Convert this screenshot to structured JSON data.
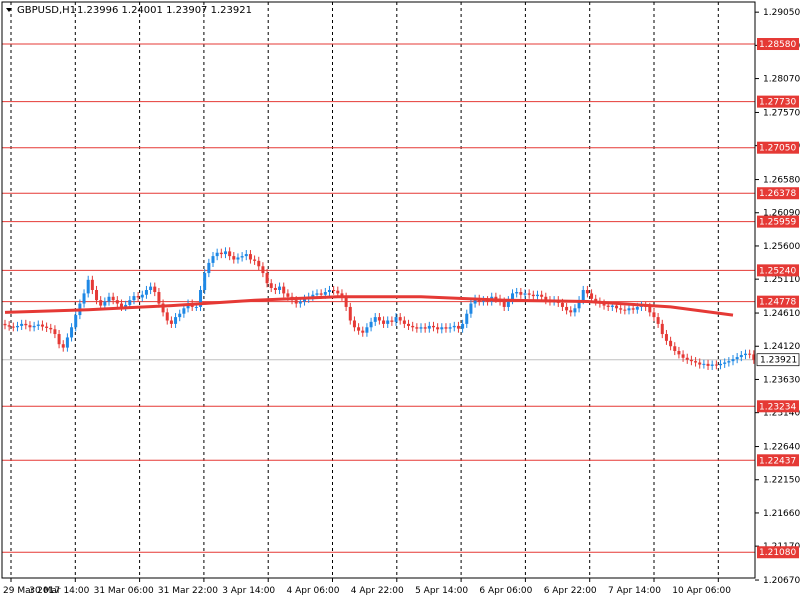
{
  "header": {
    "symbol": "GBPUSD,H1",
    "ohlc": "1.23996 1.24001 1.23907 1.23921"
  },
  "colors": {
    "background": "#ffffff",
    "up_candle": "#1e88e5",
    "down_candle": "#e53935",
    "level_line": "#e53935",
    "moving_average": "#e53935",
    "grid": "#000000"
  },
  "chart_data": {
    "type": "candlestick",
    "ylim": [
      1.207,
      1.292
    ],
    "y_ticks": [
      "1.29050",
      "1.28560",
      "1.28070",
      "1.27570",
      "1.27080",
      "1.26580",
      "1.26090",
      "1.25600",
      "1.25110",
      "1.24610",
      "1.24120",
      "1.23630",
      "1.23140",
      "1.22640",
      "1.22150",
      "1.21660",
      "1.21170",
      "1.20670"
    ],
    "x_labels": [
      "29 Mar 2017",
      "30 Mar 14:00",
      "31 Mar 06:00",
      "31 Mar 22:00",
      "3 Apr 14:00",
      "4 Apr 06:00",
      "4 Apr 22:00",
      "5 Apr 14:00",
      "6 Apr 06:00",
      "6 Apr 22:00",
      "7 Apr 14:00",
      "10 Apr 06:00"
    ],
    "levels": [
      "1.28580",
      "1.27730",
      "1.27050",
      "1.26378",
      "1.25959",
      "1.25240",
      "1.24778",
      "1.23234",
      "1.22437",
      "1.21080"
    ],
    "current_price": "1.23921",
    "grid": "vertical dashed",
    "closes": [
      1.2443,
      1.2441,
      1.244,
      1.2442,
      1.2445,
      1.2443,
      1.244,
      1.2442,
      1.2444,
      1.2441,
      1.2439,
      1.2437,
      1.243,
      1.2415,
      1.241,
      1.2425,
      1.244,
      1.2458,
      1.2475,
      1.249,
      1.251,
      1.2495,
      1.248,
      1.2472,
      1.2478,
      1.2485,
      1.248,
      1.2475,
      1.247,
      1.2473,
      1.248,
      1.2486,
      1.2484,
      1.2488,
      1.2495,
      1.25,
      1.2492,
      1.2475,
      1.2462,
      1.245,
      1.2445,
      1.2455,
      1.246,
      1.2468,
      1.2475,
      1.247,
      1.247,
      1.2495,
      1.252,
      1.2535,
      1.2545,
      1.255,
      1.2548,
      1.2552,
      1.2545,
      1.254,
      1.2543,
      1.2545,
      1.2548,
      1.254,
      1.2538,
      1.253,
      1.252,
      1.2505,
      1.2498,
      1.2495,
      1.25,
      1.249,
      1.2485,
      1.248,
      1.2475,
      1.2478,
      1.2482,
      1.2485,
      1.2488,
      1.249,
      1.2488,
      1.2492,
      1.2495,
      1.2494,
      1.249,
      1.2485,
      1.247,
      1.245,
      1.244,
      1.2435,
      1.2432,
      1.244,
      1.2448,
      1.2455,
      1.245,
      1.2445,
      1.245,
      1.2448,
      1.2455,
      1.245,
      1.2445,
      1.2442,
      1.244,
      1.2438,
      1.244,
      1.2438,
      1.2442,
      1.244,
      1.2437,
      1.244,
      1.2438,
      1.244,
      1.2442,
      1.2438,
      1.2445,
      1.246,
      1.2475,
      1.2482,
      1.2478,
      1.248,
      1.2478,
      1.2485,
      1.2482,
      1.2478,
      1.247,
      1.248,
      1.249,
      1.2492,
      1.2488,
      1.249,
      1.2488,
      1.2486,
      1.2488,
      1.2485,
      1.248,
      1.2478,
      1.248,
      1.2476,
      1.247,
      1.2465,
      1.2462,
      1.2468,
      1.248,
      1.2495,
      1.249,
      1.2482,
      1.2478,
      1.2475,
      1.2472,
      1.247,
      1.2472,
      1.2468,
      1.2466,
      1.2465,
      1.2468,
      1.2466,
      1.247,
      1.2472,
      1.247,
      1.2462,
      1.2455,
      1.2445,
      1.243,
      1.242,
      1.2412,
      1.2405,
      1.24,
      1.2395,
      1.2392,
      1.239,
      1.2388,
      1.2385,
      1.2386,
      1.2383,
      1.2385,
      1.2384,
      1.2386,
      1.2388,
      1.239,
      1.2393,
      1.2396,
      1.2399,
      1.2401,
      1.24,
      1.2392
    ],
    "ma_points": [
      [
        0,
        1.2462
      ],
      [
        20,
        1.2466
      ],
      [
        40,
        1.2472
      ],
      [
        60,
        1.248
      ],
      [
        80,
        1.2485
      ],
      [
        100,
        1.2485
      ],
      [
        120,
        1.248
      ],
      [
        140,
        1.2478
      ],
      [
        160,
        1.247
      ],
      [
        175,
        1.2458
      ]
    ]
  }
}
